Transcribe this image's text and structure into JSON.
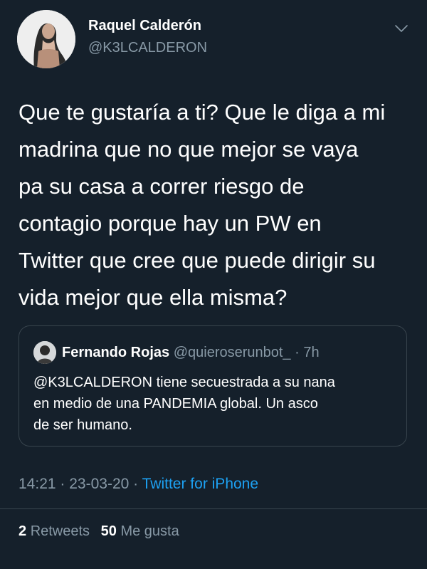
{
  "author": {
    "display_name": "Raquel Calderón",
    "handle": "@K3LCALDERON"
  },
  "tweet": {
    "text_lines": [
      "Que te gustaría a ti? Que le diga a mi",
      "madrina que no que mejor se vaya",
      "pa su casa a correr riesgo de",
      "contagio porque hay un PW en",
      "Twitter que cree que puede dirigir su",
      "vida mejor que ella misma?"
    ]
  },
  "quoted_tweet": {
    "display_name": "Fernando Rojas",
    "handle": "@quieroserunbot_",
    "separator": "·",
    "time": "7h",
    "text_lines": [
      "@K3LCALDERON tiene secuestrada a su nana",
      "en medio de una PANDEMIA global. Un asco",
      "de ser humano."
    ]
  },
  "meta": {
    "time": "14:21",
    "separator": "·",
    "date": "23-03-20",
    "source": "Twitter for iPhone"
  },
  "stats": {
    "retweets_count": "2",
    "retweets_label": "Retweets",
    "likes_count": "50",
    "likes_label": "Me gusta"
  },
  "icons": {
    "menu": "chevron-down-icon"
  },
  "colors": {
    "background": "#15202b",
    "secondary_text": "#8899a6",
    "link": "#1da1f2",
    "border": "#38444d"
  }
}
